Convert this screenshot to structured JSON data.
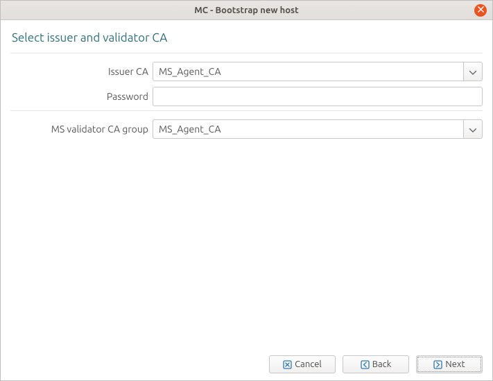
{
  "window": {
    "title": "MC - Bootstrap new host"
  },
  "heading": "Select issuer and validator CA",
  "form": {
    "issuer_ca": {
      "label": "Issuer CA",
      "value": "MS_Agent_CA"
    },
    "password": {
      "label": "Password",
      "value": ""
    },
    "validator_group": {
      "label": "MS validator CA group",
      "value": "MS_Agent_CA"
    }
  },
  "buttons": {
    "cancel": "Cancel",
    "back": "Back",
    "next": "Next"
  }
}
